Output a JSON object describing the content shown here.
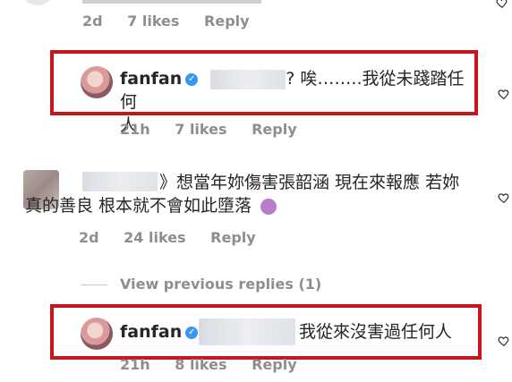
{
  "comment_top": {
    "time": "2d",
    "likes": "7 likes",
    "reply": "Reply"
  },
  "reply1": {
    "username": "fanfan",
    "text_line1": "? 唉……..我從未踐踏任何",
    "text_line2": "人",
    "time": "21h",
    "likes": "7 likes",
    "reply": "Reply"
  },
  "comment2": {
    "text_line1": "》想當年妳傷害張韶涵 現在來報應 若妳",
    "text_line2": "真的善良 根本就不會如此墮落",
    "time": "2d",
    "likes": "24 likes",
    "reply": "Reply"
  },
  "view_previous": "View previous replies (1)",
  "reply2": {
    "username": "fanfan",
    "text": "我從來沒害過任何人",
    "time": "21h",
    "likes": "8 likes",
    "reply": "Reply"
  },
  "colors": {
    "highlight_border": "#c4161c",
    "verified_badge": "#3897f0",
    "meta_text": "#8e8e8e"
  },
  "icons": [
    "heart-icon",
    "verified-badge-icon",
    "woman-gesturing-emoji"
  ]
}
